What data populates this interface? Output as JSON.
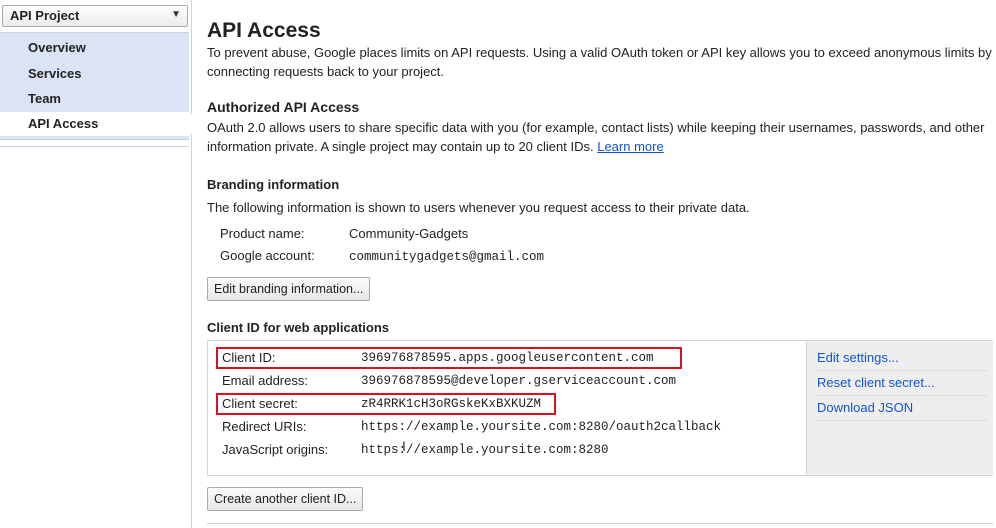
{
  "sidebar": {
    "project_select": "API Project",
    "items": [
      {
        "label": "Overview"
      },
      {
        "label": "Services"
      },
      {
        "label": "Team"
      },
      {
        "label": "API Access"
      }
    ]
  },
  "main": {
    "title": "API Access",
    "intro": "To prevent abuse, Google places limits on API requests. Using a valid OAuth token or API key allows you to exceed anonymous limits by connecting requests back to your project.",
    "authorized": {
      "heading": "Authorized API Access",
      "text_line1": "OAuth 2.0 allows users to share specific data with you (for example, contact lists) while keeping their usernames, passwords, and other",
      "text_line2": "information private. A single project may contain up to 20 client IDs.",
      "learn_more": "Learn more"
    },
    "branding": {
      "heading": "Branding information",
      "text": "The following information is shown to users whenever you request access to their private data.",
      "product_label": "Product name:",
      "product_value": "Community-Gadgets",
      "account_label": "Google account:",
      "account_value": "communitygadgets@gmail.com",
      "edit_button": "Edit branding information..."
    },
    "client": {
      "heading": "Client ID for web applications",
      "rows": [
        {
          "label": "Client ID:",
          "value": "396976878595.apps.googleusercontent.com"
        },
        {
          "label": "Email address:",
          "value": "396976878595@developer.gserviceaccount.com"
        },
        {
          "label": "Client secret:",
          "value": "zR4RRK1cH3oRGskeKxBXKUZM"
        },
        {
          "label": "Redirect URIs:",
          "value": "https://example.yoursite.com:8280/oauth2callback"
        },
        {
          "label": "JavaScript origins:",
          "value": "https://example.yoursite.com:8280"
        }
      ],
      "actions": {
        "edit_settings": "Edit settings...",
        "reset_secret": "Reset client secret...",
        "download_json": "Download JSON"
      },
      "create_button": "Create another client ID..."
    }
  },
  "colors": {
    "nav_bg": "#dbe4f5",
    "link": "#1155cc",
    "highlight": "#d4141b"
  }
}
